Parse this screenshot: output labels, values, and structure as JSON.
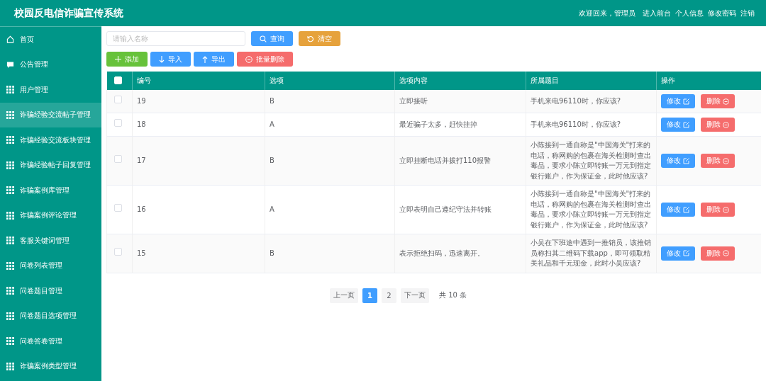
{
  "header": {
    "title": "校园反电信诈骗宣传系统",
    "links": [
      "欢迎回来，管理员",
      "进入前台",
      "个人信息",
      "修改密码",
      "注销"
    ]
  },
  "sidebar": {
    "items": [
      {
        "label": "首页",
        "kind": "home",
        "selected": false
      },
      {
        "label": "公告管理",
        "kind": "chat",
        "selected": false
      },
      {
        "label": "用户管理",
        "kind": "grid",
        "selected": false
      },
      {
        "label": "诈骗经验交流帖子管理",
        "kind": "grid",
        "selected": true
      },
      {
        "label": "诈骗经验交流板块管理",
        "kind": "grid",
        "selected": false
      },
      {
        "label": "诈骗经验帖子回复管理",
        "kind": "grid",
        "selected": false
      },
      {
        "label": "诈骗案例库管理",
        "kind": "grid",
        "selected": false
      },
      {
        "label": "诈骗案例评论管理",
        "kind": "grid",
        "selected": false
      },
      {
        "label": "客服关键词管理",
        "kind": "grid",
        "selected": false
      },
      {
        "label": "问卷列表管理",
        "kind": "grid",
        "selected": false
      },
      {
        "label": "问卷题目管理",
        "kind": "grid",
        "selected": false
      },
      {
        "label": "问卷题目选项管理",
        "kind": "grid",
        "selected": false
      },
      {
        "label": "问卷答卷管理",
        "kind": "grid",
        "selected": false
      },
      {
        "label": "诈骗案例类型管理",
        "kind": "grid",
        "selected": false
      }
    ]
  },
  "search": {
    "placeholder": "请输入名称",
    "buttons": [
      {
        "label": "查询",
        "kind": "search"
      },
      {
        "label": "清空",
        "kind": "reset"
      }
    ]
  },
  "toolbar": [
    {
      "label": "添加",
      "kind": "add"
    },
    {
      "label": "导入",
      "kind": "import"
    },
    {
      "label": "导出",
      "kind": "export"
    },
    {
      "label": "批量删除",
      "kind": "delete"
    }
  ],
  "table": {
    "select_all": {
      "checked": false
    },
    "columns": [
      "编号",
      "选项",
      "选项内容",
      "所属题目",
      "操作"
    ],
    "rows": [
      {
        "checked": false,
        "id": "19",
        "option": "B",
        "content": "立即接听",
        "question": "手机来电96110时，你应该?",
        "actions": [
          "修改",
          "删除"
        ]
      },
      {
        "checked": false,
        "id": "18",
        "option": "A",
        "content": "最近骗子太多，赶快挂掉",
        "question": "手机来电96110时，你应该?",
        "actions": [
          "修改",
          "删除"
        ]
      },
      {
        "checked": false,
        "id": "17",
        "option": "B",
        "content": "立即挂断电话并拨打110报警",
        "question": "小陈接到一通自称是\"中国海关\"打来的电话，称网购的包裹在海关检测时查出毒品，要求小陈立即转账一万元到指定银行账户，作为保证金，此时他应该?",
        "actions": [
          "修改",
          "删除"
        ]
      },
      {
        "checked": false,
        "id": "16",
        "option": "A",
        "content": "立即表明自己遵纪守法并转账",
        "question": "小陈接到一通自称是\"中国海关\"打来的电话，称网购的包裹在海关检测时查出毒品，要求小陈立即转账一万元到指定银行账户，作为保证金，此时他应该?",
        "actions": [
          "修改",
          "删除"
        ]
      },
      {
        "checked": false,
        "id": "15",
        "option": "B",
        "content": "表示拒绝扫码，迅速离开。",
        "question": "小吴在下班途中遇到一推销员，该推销员称扫其二维码下载app，即可领取精美礼品和千元现金，此时小吴应该?",
        "actions": [
          "修改",
          "删除"
        ]
      }
    ]
  },
  "pagination": {
    "prev": "上一页",
    "pages": [
      {
        "label": "1",
        "selected": true
      },
      {
        "label": "2",
        "selected": false
      }
    ],
    "next": "下一页",
    "total": "共 10 条"
  }
}
